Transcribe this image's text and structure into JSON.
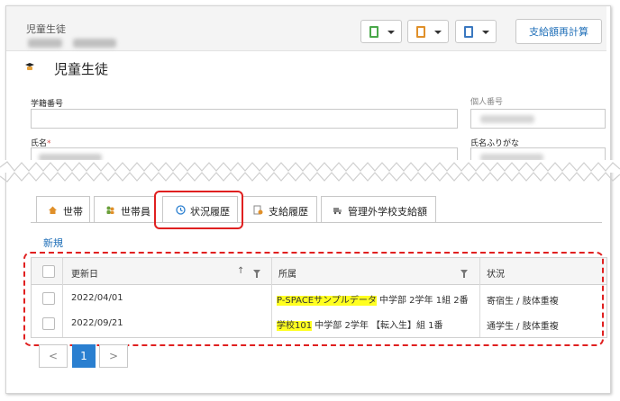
{
  "header": {
    "title": "児童生徒",
    "recalc_button": "支給額再計算",
    "tool_icons": [
      "clipboard-green-icon",
      "clipboard-orange-icon",
      "clipboard-blue-icon"
    ]
  },
  "page": {
    "title": "児童生徒"
  },
  "fields": {
    "student_no_label": "学籍番号",
    "personal_no_label": "個人番号",
    "name_label": "氏名",
    "name_required_mark": "*",
    "name_kana_label": "氏名ふりがな"
  },
  "tabs": [
    {
      "label": "世帯",
      "icon": "house-icon"
    },
    {
      "label": "世帯員",
      "icon": "people-icon"
    },
    {
      "label": "状況履歴",
      "icon": "clock-icon",
      "active": true
    },
    {
      "label": "支給履歴",
      "icon": "ledger-icon"
    },
    {
      "label": "管理外学校支給額",
      "icon": "truck-icon"
    }
  ],
  "actions": {
    "new_link": "新規"
  },
  "grid": {
    "columns": [
      "更新日",
      "所属",
      "状況"
    ],
    "sort_icon": "↑",
    "rows": [
      {
        "date": "2022/04/01",
        "school_highlight": "P-SPACEサンプルデータ",
        "school_rest": " 中学部 2学年 1組 2番",
        "status": "寄宿生 / 肢体重複"
      },
      {
        "date": "2022/09/21",
        "school_highlight": "学校101",
        "school_rest": " 中学部 2学年 【転入生】組 1番",
        "status": "通学生 / 肢体重複"
      }
    ]
  },
  "pager": {
    "prev": "<",
    "current": "1",
    "next": ">"
  },
  "colors": {
    "accent": "#1f6fb8",
    "highlight": "#ffff20",
    "annotation": "#e02020"
  }
}
